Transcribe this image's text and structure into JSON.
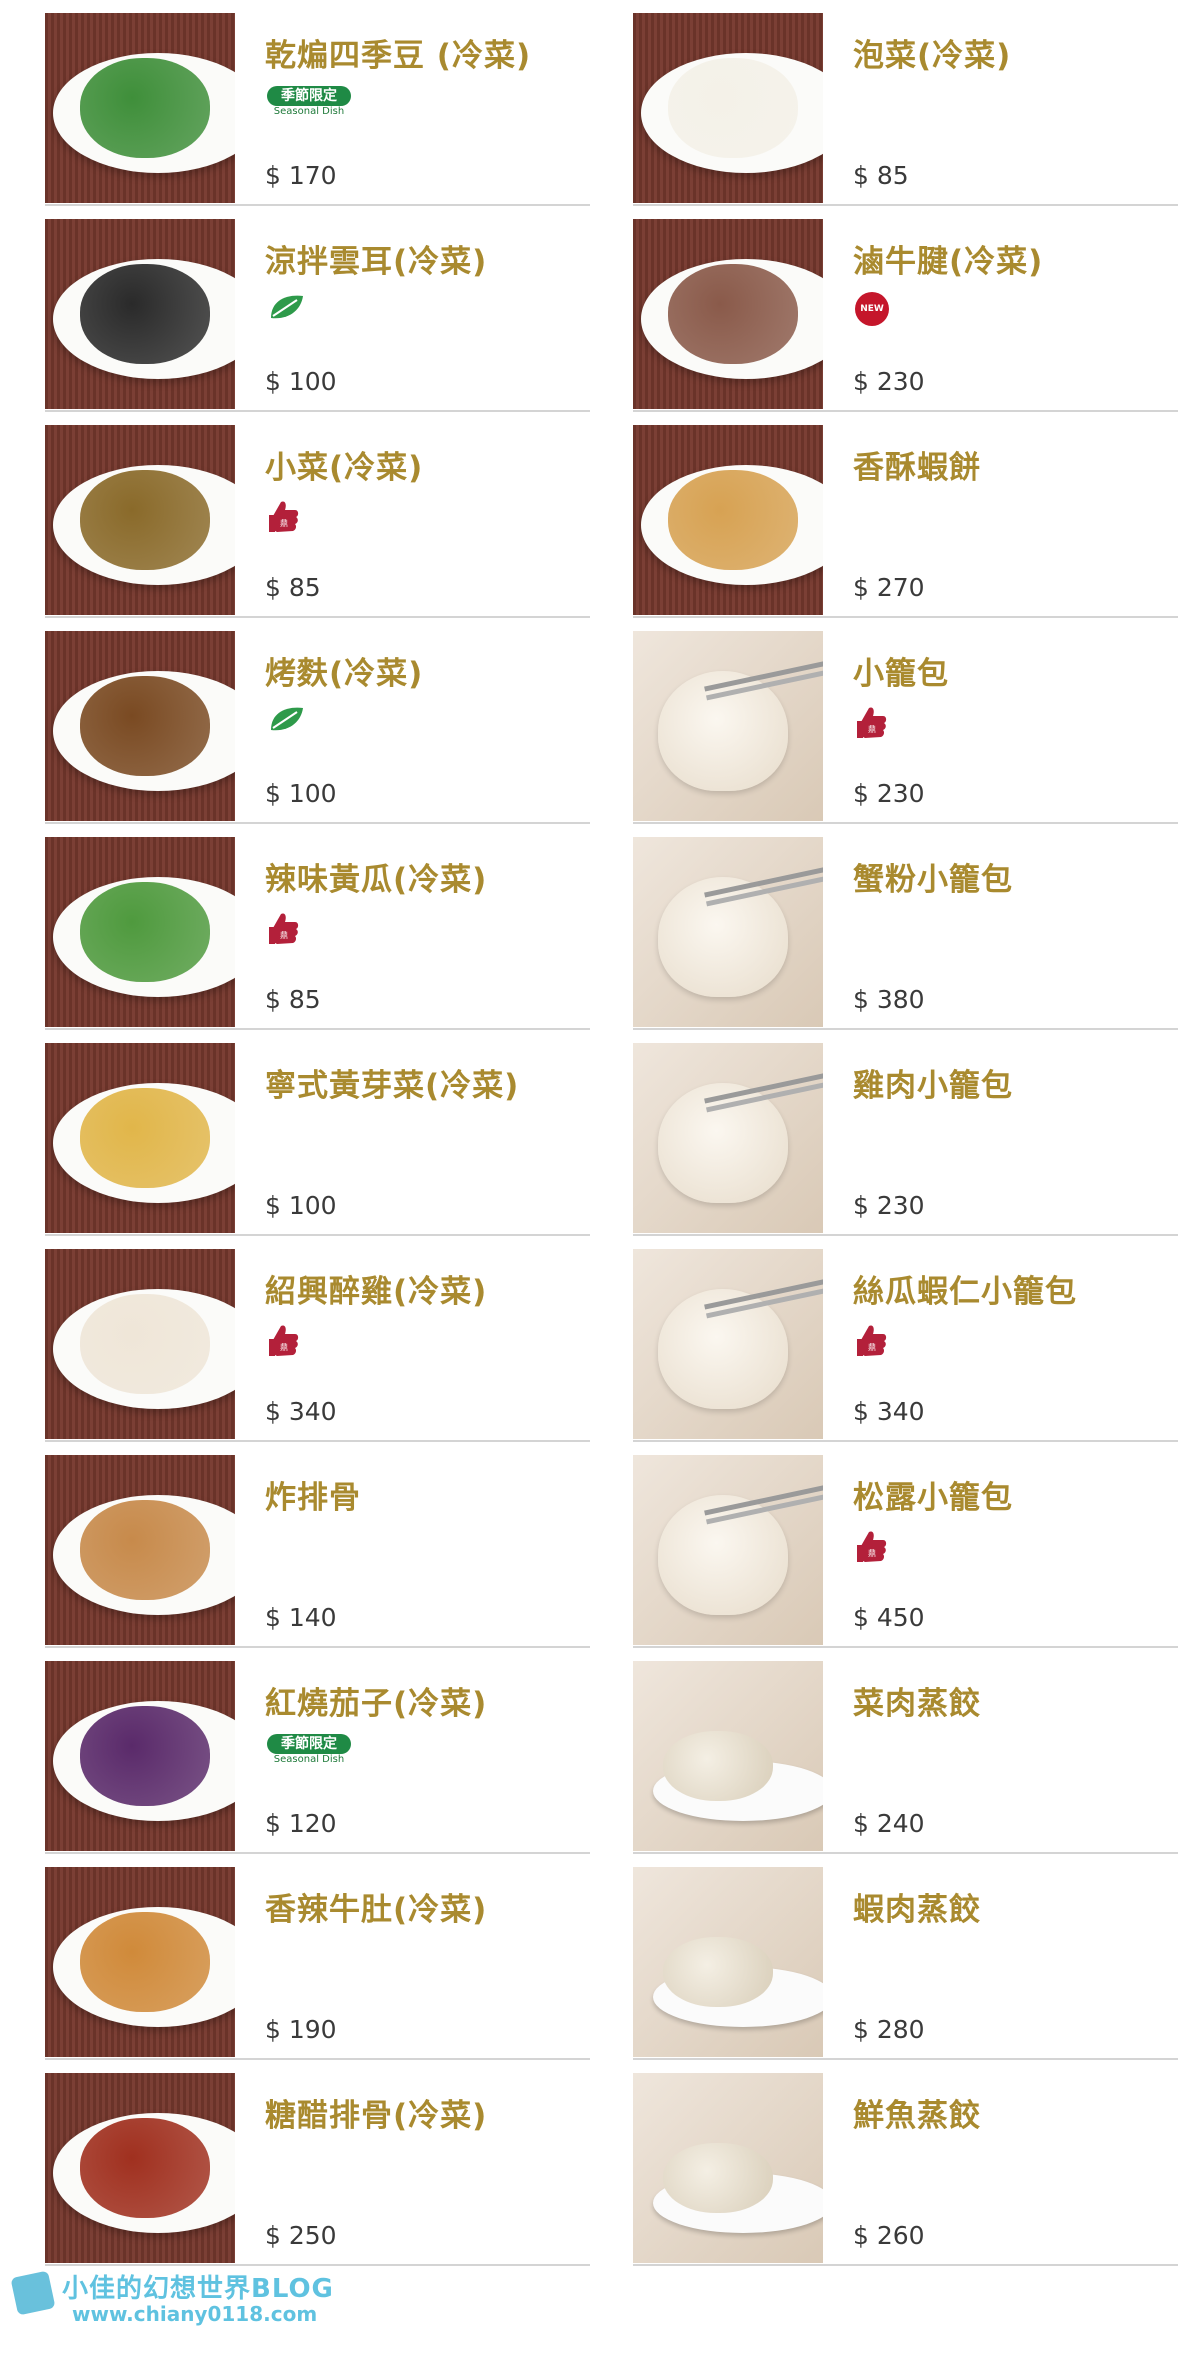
{
  "left_items": [
    {
      "name": "乾煸四季豆 (冷菜)",
      "price": "$ 170",
      "badge": "seasonal",
      "photo": "wood"
    },
    {
      "name": "涼拌雲耳(冷菜)",
      "price": "$ 100",
      "badge": "leaf",
      "photo": "wood"
    },
    {
      "name": "小菜(冷菜)",
      "price": "$ 85",
      "badge": "thumb",
      "photo": "wood"
    },
    {
      "name": "烤麩(冷菜)",
      "price": "$ 100",
      "badge": "leaf",
      "photo": "wood"
    },
    {
      "name": "辣味黃瓜(冷菜)",
      "price": "$ 85",
      "badge": "thumb",
      "photo": "wood"
    },
    {
      "name": "寧式黃芽菜(冷菜)",
      "price": "$ 100",
      "badge": "",
      "photo": "wood"
    },
    {
      "name": "紹興醉雞(冷菜)",
      "price": "$ 340",
      "badge": "thumb",
      "photo": "wood"
    },
    {
      "name": "炸排骨",
      "price": "$ 140",
      "badge": "",
      "photo": "wood"
    },
    {
      "name": "紅燒茄子(冷菜)",
      "price": "$ 120",
      "badge": "seasonal",
      "photo": "wood"
    },
    {
      "name": "香辣牛肚(冷菜)",
      "price": "$ 190",
      "badge": "",
      "photo": "wood"
    },
    {
      "name": "糖醋排骨(冷菜)",
      "price": "$ 250",
      "badge": "",
      "photo": "wood"
    }
  ],
  "right_items": [
    {
      "name": "泡菜(冷菜)",
      "price": "$ 85",
      "badge": "",
      "photo": "wood"
    },
    {
      "name": "滷牛腱(冷菜)",
      "price": "$ 230",
      "badge": "new",
      "photo": "wood"
    },
    {
      "name": "香酥蝦餅",
      "price": "$ 270",
      "badge": "",
      "photo": "wood"
    },
    {
      "name": "小籠包",
      "price": "$ 230",
      "badge": "thumb",
      "photo": "bun"
    },
    {
      "name": "蟹粉小籠包",
      "price": "$ 380",
      "badge": "",
      "photo": "bun"
    },
    {
      "name": "雞肉小籠包",
      "price": "$ 230",
      "badge": "",
      "photo": "bun"
    },
    {
      "name": "絲瓜蝦仁小籠包",
      "price": "$ 340",
      "badge": "thumb",
      "photo": "bun"
    },
    {
      "name": "松露小籠包",
      "price": "$ 450",
      "badge": "thumb",
      "photo": "bun"
    },
    {
      "name": "菜肉蒸餃",
      "price": "$ 240",
      "badge": "",
      "photo": "spoon"
    },
    {
      "name": "蝦肉蒸餃",
      "price": "$ 280",
      "badge": "",
      "photo": "spoon"
    },
    {
      "name": "鮮魚蒸餃",
      "price": "$ 260",
      "badge": "",
      "photo": "spoon"
    }
  ],
  "badges": {
    "seasonal_line1": "季節限定",
    "seasonal_line2": "Seasonal Dish",
    "new_label": "NEW"
  },
  "watermark": {
    "line1": "小佳的幻想世界BLOG",
    "line2": "www.chiany0118.com"
  },
  "colors": {
    "name": "#a98a2f",
    "price": "#3a3a3a",
    "seasonal_badge": "#1f8a45",
    "new_badge": "#c5162b",
    "thumb_icon": "#b3203a",
    "divider": "#d4d4d4"
  }
}
